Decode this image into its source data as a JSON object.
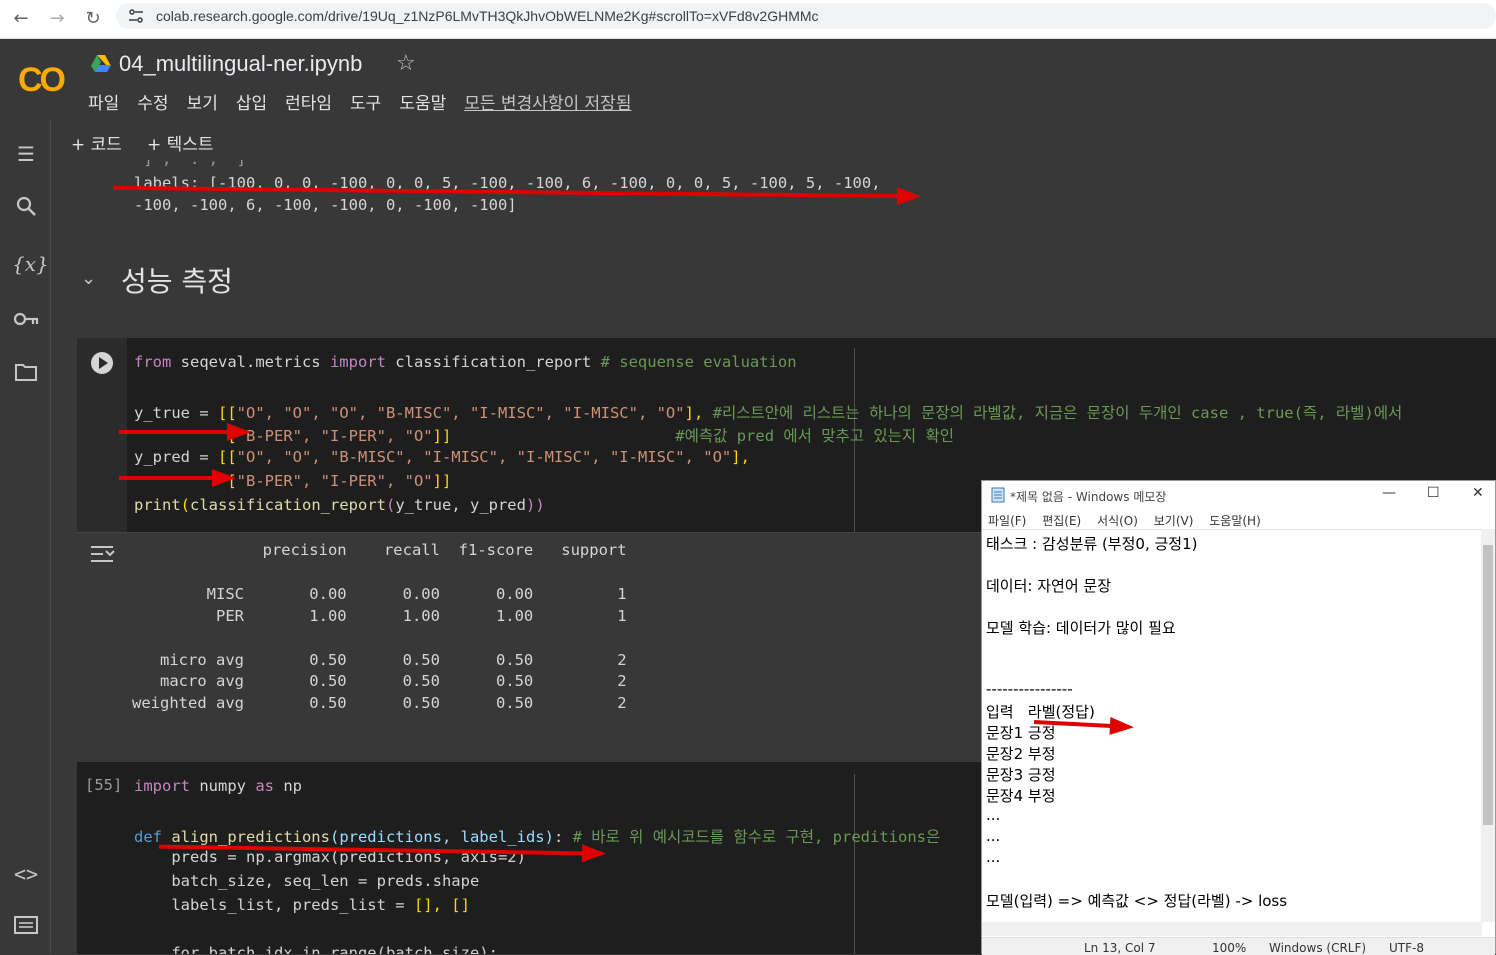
{
  "browser": {
    "url": "colab.research.google.com/drive/19Uq_z1NzP6LMvTH3QkJhvObWELNMe2Kg#scrollTo=xVFd8v2GHMMc"
  },
  "header": {
    "logo": "CO",
    "title": "04_multilingual-ner.ipynb",
    "menu": [
      "파일",
      "수정",
      "보기",
      "삽입",
      "런타임",
      "도구",
      "도움말"
    ],
    "saved_status": "모든 변경사항이 저장됨"
  },
  "toolbar": {
    "add_code": "+ 코드",
    "add_text": "+ 텍스트"
  },
  "prev_output": {
    "line0": "']', '.', ']'",
    "line1": "labels: [-100, 0, 0, -100, 0, 0, 5, -100, -100, 6, -100, 0, 0, 5, -100, 5, -100,",
    "line2": "-100, -100, 6, -100, -100, 0, -100, -100]"
  },
  "section": {
    "title": "성능 측정"
  },
  "cell1": {
    "l1_from": "from",
    "l1_mod": " seqeval.metrics ",
    "l1_import": "import",
    "l1_name": " classification_report ",
    "l1_cmt": "# sequense evaluation",
    "l2_a": "y_true = ",
    "l2_b": "[[",
    "l2_c": "\"O\", \"O\", \"O\", \"B-MISC\", \"I-MISC\", \"I-MISC\", \"O\"",
    "l2_d": "],",
    "l2_cmt": " #리스트안에 리스트는 하나의 문장의 라벨값, 지금은 문장이 두개인 case , true(즉, 라벨)에서",
    "l3_a": "          [",
    "l3_c": "\"B-PER\", \"I-PER\", \"O\"",
    "l3_d": "]]",
    "l3_cmt": "                        #예측값 pred 에서 맞추고 있는지 확인",
    "l4_a": "y_pred = ",
    "l4_b": "[[",
    "l4_c": "\"O\", \"O\", \"B-MISC\", \"I-MISC\", \"I-MISC\", \"I-MISC\", \"O\"",
    "l4_d": "],",
    "l5_a": "          [",
    "l5_c": "\"B-PER\", \"I-PER\", \"O\"",
    "l5_d": "]]",
    "l6_fn": "print",
    "l6_p": "(",
    "l6_mid": "classification_report",
    "l6_p2": "(",
    "l6_args": "y_true, y_pred",
    "l6_end": "))"
  },
  "report": {
    "header": "              precision    recall  f1-score   support",
    "rows": [
      "        MISC       0.00      0.00      0.00         1",
      "         PER       1.00      1.00      1.00         1",
      "",
      "   micro avg       0.50      0.50      0.50         2",
      "   macro avg       0.50      0.50      0.50         2",
      "weighted avg       0.50      0.50      0.50         2"
    ]
  },
  "cell2": {
    "exec_count": "[55]",
    "l1_import": "import",
    "l1_mod": " numpy ",
    "l1_as": "as",
    "l1_np": " np",
    "l2_def": "def",
    "l2_fn": " align_predictions",
    "l2_args": "(predictions, label_ids)",
    "l2_colon": ":",
    "l2_cmt": " # 바로 위 예시코드를 함수로 구현, preditions은",
    "l3": "    preds = np.argmax(predictions, axis=2)",
    "l4": "    batch_size, seq_len = preds.shape",
    "l5_a": "    labels_list, preds_list = ",
    "l5_b": "[], []",
    "l6": "    for batch_idx in range(batch_size):"
  },
  "notepad": {
    "title": "*제목 없음 - Windows 메모장",
    "menu": [
      "파일(F)",
      "편집(E)",
      "서식(O)",
      "보기(V)",
      "도움말(H)"
    ],
    "lines": [
      "태스크 : 감성분류 (부정0, 긍정1)",
      "",
      "데이터: 자연어 문장",
      "",
      "모델 학습: 데이터가 많이 필요",
      "",
      "",
      "----------------",
      "입력   라벨(정답)",
      "문장1 긍정",
      "문장2 부정",
      "문장3 긍정",
      "문장4 부정",
      "...",
      "...",
      "...",
      "",
      "모델(입력) => 예측값 <> 정답(라벨) -> loss"
    ],
    "status_pos": "Ln 13, Col 7",
    "status_zoom": "100%",
    "status_eol": "Windows (CRLF)",
    "status_enc": "UTF-8"
  },
  "colors": {
    "annotation_arrow": "#e00000",
    "logo_orange": "#f9ab00"
  }
}
